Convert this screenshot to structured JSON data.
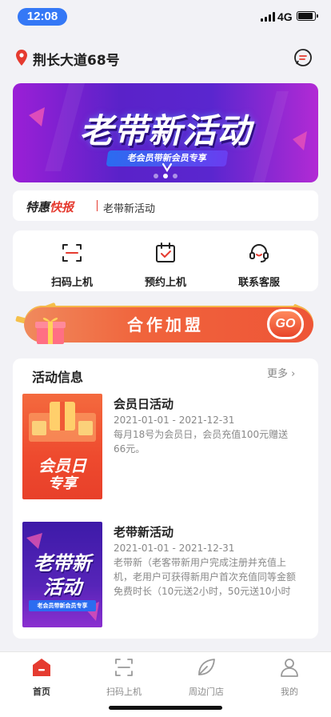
{
  "status_bar": {
    "time": "12:08",
    "network": "4G"
  },
  "header": {
    "location": "荆长大道68号",
    "pin_icon": "location-pin-icon",
    "message_icon": "message-icon"
  },
  "banner": {
    "title": "老带新活动",
    "subtitle": "老会员带新会员专享",
    "slide_count": 3,
    "active_slide": 1
  },
  "news": {
    "tag_black": "特惠",
    "tag_red": "快报",
    "text": "老带新活动"
  },
  "actions": [
    {
      "label": "扫码上机",
      "icon": "scan-icon"
    },
    {
      "label": "预约上机",
      "icon": "calendar-check-icon"
    },
    {
      "label": "联系客服",
      "icon": "headset-icon"
    }
  ],
  "join_banner": {
    "text": "合作加盟",
    "go": "GO"
  },
  "activity": {
    "title": "活动信息",
    "more": "更多",
    "items": [
      {
        "name": "会员日活动",
        "date": "2021-01-01 - 2021-12-31",
        "desc": "每月18号为会员日，会员充值100元赠送66元。",
        "thumb_text_1": "会员日",
        "thumb_text_2": "专享"
      },
      {
        "name": "老带新活动",
        "date": "2021-01-01 - 2021-12-31",
        "desc": "老带新（老客带新用户完成注册并充值上机，老用户可获得新用户首次充值同等金额免费时长（10元送2小时，50元送10小时以",
        "thumb_text_1": "老带新",
        "thumb_text_2": "活动",
        "thumb_text_3": "老会员带新会员专享"
      }
    ]
  },
  "tabbar": [
    {
      "label": "首页",
      "icon": "home-icon",
      "active": true
    },
    {
      "label": "扫码上机",
      "icon": "scan-icon",
      "active": false
    },
    {
      "label": "周边门店",
      "icon": "leaf-icon",
      "active": false
    },
    {
      "label": "我的",
      "icon": "user-icon",
      "active": false
    }
  ],
  "colors": {
    "accent_red": "#e53b30",
    "banner_purple": "#5a22c9",
    "status_blue": "#3478f6"
  }
}
